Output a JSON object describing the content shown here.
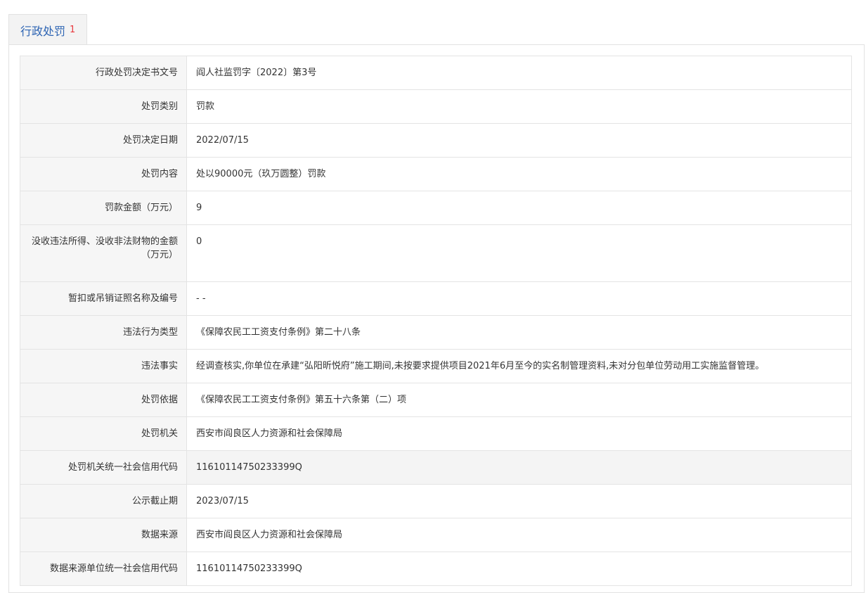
{
  "tab": {
    "label": "行政处罚",
    "count": "1"
  },
  "rows": [
    {
      "label": "行政处罚决定书文号",
      "value": "阎人社监罚字〔2022〕第3号"
    },
    {
      "label": "处罚类别",
      "value": "罚款"
    },
    {
      "label": "处罚决定日期",
      "value": "2022/07/15"
    },
    {
      "label": "处罚内容",
      "value": "处以90000元（玖万圆整）罚款"
    },
    {
      "label": "罚款金额（万元）",
      "value": "9"
    },
    {
      "label": "没收违法所得、没收非法财物的金额（万元）",
      "value": "0"
    },
    {
      "label": "暂扣或吊销证照名称及编号",
      "value": "- -"
    },
    {
      "label": "违法行为类型",
      "value": "《保障农民工工资支付条例》第二十八条"
    },
    {
      "label": "违法事实",
      "value": "经调查核实,你单位在承建“弘阳昕悦府”施工期间,未按要求提供项目2021年6月至今的实名制管理资料,未对分包单位劳动用工实施监督管理。"
    },
    {
      "label": "处罚依据",
      "value": "《保障农民工工资支付条例》第五十六条第（二）项"
    },
    {
      "label": "处罚机关",
      "value": "西安市阎良区人力资源和社会保障局"
    },
    {
      "label": "处罚机关统一社会信用代码",
      "value": "11610114750233399Q"
    },
    {
      "label": "公示截止期",
      "value": "2023/07/15"
    },
    {
      "label": "数据来源",
      "value": "西安市阎良区人力资源和社会保障局"
    },
    {
      "label": "数据来源单位统一社会信用代码",
      "value": "11610114750233399Q"
    }
  ]
}
